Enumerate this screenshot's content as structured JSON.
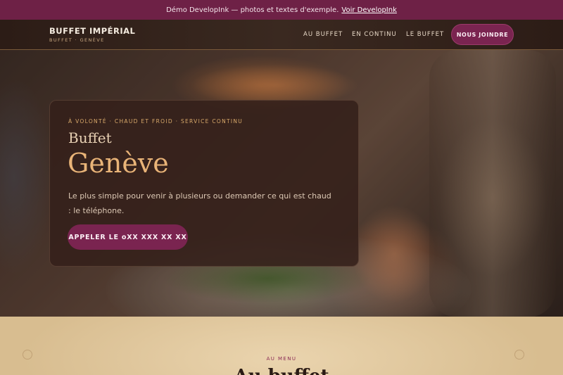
{
  "demo_bar": {
    "text": "Démo DevelopInk — photos et textes d'exemple.",
    "link": "Voir DevelopInk"
  },
  "header": {
    "brand_title": "BUFFET IMPÉRIAL",
    "brand_sub": "BUFFET · GENÈVE",
    "nav": [
      "AU BUFFET",
      "EN CONTINU",
      "LE BUFFET"
    ],
    "cta": "NOUS JOINDRE"
  },
  "hero": {
    "kicker": "À VOLONTÉ · CHAUD ET FROID · SERVICE CONTINU",
    "title_small": "Buffet",
    "title_big": "Genève",
    "lead": "Le plus simple pour venir à plusieurs ou demander ce qui est chaud : le téléphone.",
    "cta": "APPELER LE oXX XXX XX XX"
  },
  "section": {
    "kicker": "AU MENU",
    "title": "Au buffet"
  },
  "colors": {
    "accent": "#7a2450",
    "gold": "#e9b478",
    "header_bg": "#2c1c16",
    "section_bg": "#e3c9a0"
  }
}
